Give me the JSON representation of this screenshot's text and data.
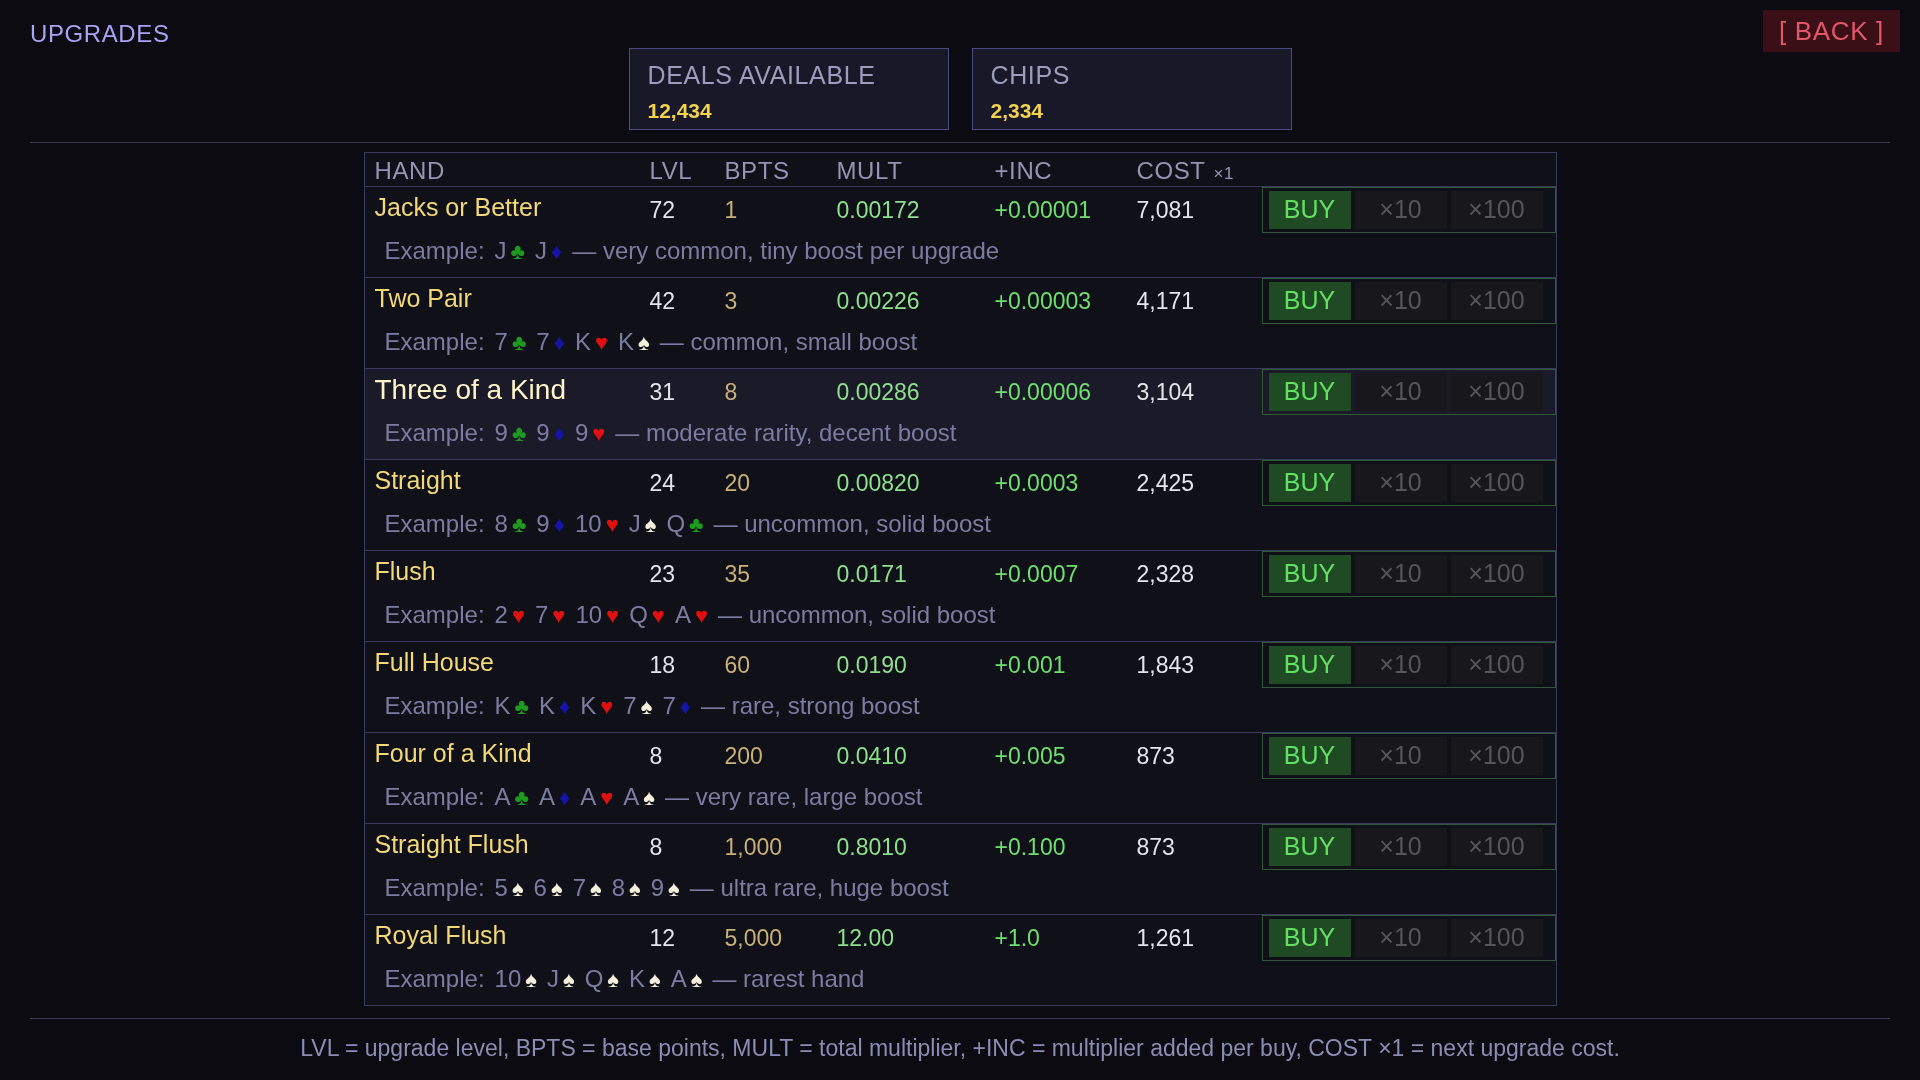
{
  "title": "UPGRADES",
  "back_button": "[ BACK ]",
  "stats": [
    {
      "label": "DEALS AVAILABLE",
      "value": "12,434"
    },
    {
      "label": "CHIPS",
      "value": "2,334"
    }
  ],
  "table": {
    "columns": [
      {
        "label": "HAND"
      },
      {
        "label": "LVL"
      },
      {
        "label": "BPTS"
      },
      {
        "label": "MULT"
      },
      {
        "label": "+INC"
      },
      {
        "label": "COST",
        "suffix": "×1"
      }
    ],
    "rows": [
      {
        "hand": "Jacks or Better",
        "lvl": "72",
        "bpts": "1",
        "mult": "0.00172",
        "inc": "+0.00001",
        "cost": "7,081",
        "highlighted": false,
        "example_label": "Example:",
        "cards": [
          {
            "rank": "J",
            "suit": "♣",
            "color": "#1e9a1e"
          },
          {
            "rank": "J",
            "suit": "♦",
            "color": "#1414a8"
          }
        ],
        "note": "— very common, tiny boost per upgrade",
        "buttons": [
          {
            "label": "BUY",
            "disabled": false
          },
          {
            "label": "×10",
            "disabled": true
          },
          {
            "label": "×100",
            "disabled": true
          }
        ]
      },
      {
        "hand": "Two Pair",
        "lvl": "42",
        "bpts": "3",
        "mult": "0.00226",
        "inc": "+0.00003",
        "cost": "4,171",
        "highlighted": false,
        "example_label": "Example:",
        "cards": [
          {
            "rank": "7",
            "suit": "♣",
            "color": "#1e9a1e"
          },
          {
            "rank": "7",
            "suit": "♦",
            "color": "#1414a8"
          },
          {
            "rank": "K",
            "suit": "♥",
            "color": "#e01010"
          },
          {
            "rank": "K",
            "suit": "♠",
            "color": "#f4f0dc"
          }
        ],
        "note": "— common, small boost",
        "buttons": [
          {
            "label": "BUY",
            "disabled": false
          },
          {
            "label": "×10",
            "disabled": true
          },
          {
            "label": "×100",
            "disabled": true
          }
        ]
      },
      {
        "hand": "Three of a Kind",
        "lvl": "31",
        "bpts": "8",
        "mult": "0.00286",
        "inc": "+0.00006",
        "cost": "3,104",
        "highlighted": true,
        "example_label": "Example:",
        "cards": [
          {
            "rank": "9",
            "suit": "♣",
            "color": "#1e9a1e"
          },
          {
            "rank": "9",
            "suit": "♦",
            "color": "#1414a8"
          },
          {
            "rank": "9",
            "suit": "♥",
            "color": "#e01010"
          }
        ],
        "note": "— moderate rarity, decent boost",
        "buttons": [
          {
            "label": "BUY",
            "disabled": false
          },
          {
            "label": "×10",
            "disabled": true
          },
          {
            "label": "×100",
            "disabled": true
          }
        ]
      },
      {
        "hand": "Straight",
        "lvl": "24",
        "bpts": "20",
        "mult": "0.00820",
        "inc": "+0.0003",
        "cost": "2,425",
        "highlighted": false,
        "example_label": "Example:",
        "cards": [
          {
            "rank": "8",
            "suit": "♣",
            "color": "#1e9a1e"
          },
          {
            "rank": "9",
            "suit": "♦",
            "color": "#1414a8"
          },
          {
            "rank": "10",
            "suit": "♥",
            "color": "#e01010"
          },
          {
            "rank": "J",
            "suit": "♠",
            "color": "#f4f0dc"
          },
          {
            "rank": "Q",
            "suit": "♣",
            "color": "#1e9a1e"
          }
        ],
        "note": "— uncommon, solid boost",
        "buttons": [
          {
            "label": "BUY",
            "disabled": false
          },
          {
            "label": "×10",
            "disabled": true
          },
          {
            "label": "×100",
            "disabled": true
          }
        ]
      },
      {
        "hand": "Flush",
        "lvl": "23",
        "bpts": "35",
        "mult": "0.0171",
        "inc": "+0.0007",
        "cost": "2,328",
        "highlighted": false,
        "example_label": "Example:",
        "cards": [
          {
            "rank": "2",
            "suit": "♥",
            "color": "#e01010"
          },
          {
            "rank": "7",
            "suit": "♥",
            "color": "#e01010"
          },
          {
            "rank": "10",
            "suit": "♥",
            "color": "#e01010"
          },
          {
            "rank": "Q",
            "suit": "♥",
            "color": "#e01010"
          },
          {
            "rank": "A",
            "suit": "♥",
            "color": "#e01010"
          }
        ],
        "note": "— uncommon, solid boost",
        "buttons": [
          {
            "label": "BUY",
            "disabled": false
          },
          {
            "label": "×10",
            "disabled": true
          },
          {
            "label": "×100",
            "disabled": true
          }
        ]
      },
      {
        "hand": "Full House",
        "lvl": "18",
        "bpts": "60",
        "mult": "0.0190",
        "inc": "+0.001",
        "cost": "1,843",
        "highlighted": false,
        "example_label": "Example:",
        "cards": [
          {
            "rank": "K",
            "suit": "♣",
            "color": "#1e9a1e"
          },
          {
            "rank": "K",
            "suit": "♦",
            "color": "#1414a8"
          },
          {
            "rank": "K",
            "suit": "♥",
            "color": "#e01010"
          },
          {
            "rank": "7",
            "suit": "♠",
            "color": "#f4f0dc"
          },
          {
            "rank": "7",
            "suit": "♦",
            "color": "#1414a8"
          }
        ],
        "note": "— rare, strong boost",
        "buttons": [
          {
            "label": "BUY",
            "disabled": false
          },
          {
            "label": "×10",
            "disabled": true
          },
          {
            "label": "×100",
            "disabled": true
          }
        ]
      },
      {
        "hand": "Four of a Kind",
        "lvl": "8",
        "bpts": "200",
        "mult": "0.0410",
        "inc": "+0.005",
        "cost": "873",
        "highlighted": false,
        "example_label": "Example:",
        "cards": [
          {
            "rank": "A",
            "suit": "♣",
            "color": "#1e9a1e"
          },
          {
            "rank": "A",
            "suit": "♦",
            "color": "#1414a8"
          },
          {
            "rank": "A",
            "suit": "♥",
            "color": "#e01010"
          },
          {
            "rank": "A",
            "suit": "♠",
            "color": "#f4f0dc"
          }
        ],
        "note": "— very rare, large boost",
        "buttons": [
          {
            "label": "BUY",
            "disabled": false
          },
          {
            "label": "×10",
            "disabled": true
          },
          {
            "label": "×100",
            "disabled": true
          }
        ]
      },
      {
        "hand": "Straight Flush",
        "lvl": "8",
        "bpts": "1,000",
        "mult": "0.8010",
        "inc": "+0.100",
        "cost": "873",
        "highlighted": false,
        "example_label": "Example:",
        "cards": [
          {
            "rank": "5",
            "suit": "♠",
            "color": "#f4f0dc"
          },
          {
            "rank": "6",
            "suit": "♠",
            "color": "#f4f0dc"
          },
          {
            "rank": "7",
            "suit": "♠",
            "color": "#f4f0dc"
          },
          {
            "rank": "8",
            "suit": "♠",
            "color": "#f4f0dc"
          },
          {
            "rank": "9",
            "suit": "♠",
            "color": "#f4f0dc"
          }
        ],
        "note": "— ultra rare, huge boost",
        "buttons": [
          {
            "label": "BUY",
            "disabled": false
          },
          {
            "label": "×10",
            "disabled": true
          },
          {
            "label": "×100",
            "disabled": true
          }
        ]
      },
      {
        "hand": "Royal Flush",
        "lvl": "12",
        "bpts": "5,000",
        "mult": "12.00",
        "inc": "+1.0",
        "cost": "1,261",
        "highlighted": false,
        "example_label": "Example:",
        "cards": [
          {
            "rank": "10",
            "suit": "♠",
            "color": "#f4f0dc"
          },
          {
            "rank": "J",
            "suit": "♠",
            "color": "#f4f0dc"
          },
          {
            "rank": "Q",
            "suit": "♠",
            "color": "#f4f0dc"
          },
          {
            "rank": "K",
            "suit": "♠",
            "color": "#f4f0dc"
          },
          {
            "rank": "A",
            "suit": "♠",
            "color": "#f4f0dc"
          }
        ],
        "note": "— rarest hand",
        "buttons": [
          {
            "label": "BUY",
            "disabled": false
          },
          {
            "label": "×10",
            "disabled": true
          },
          {
            "label": "×100",
            "disabled": true
          }
        ]
      }
    ]
  },
  "legend": "LVL = upgrade level, BPTS = base points, MULT = total multiplier, +INC = multiplier added per buy, COST ×1 = next upgrade cost."
}
